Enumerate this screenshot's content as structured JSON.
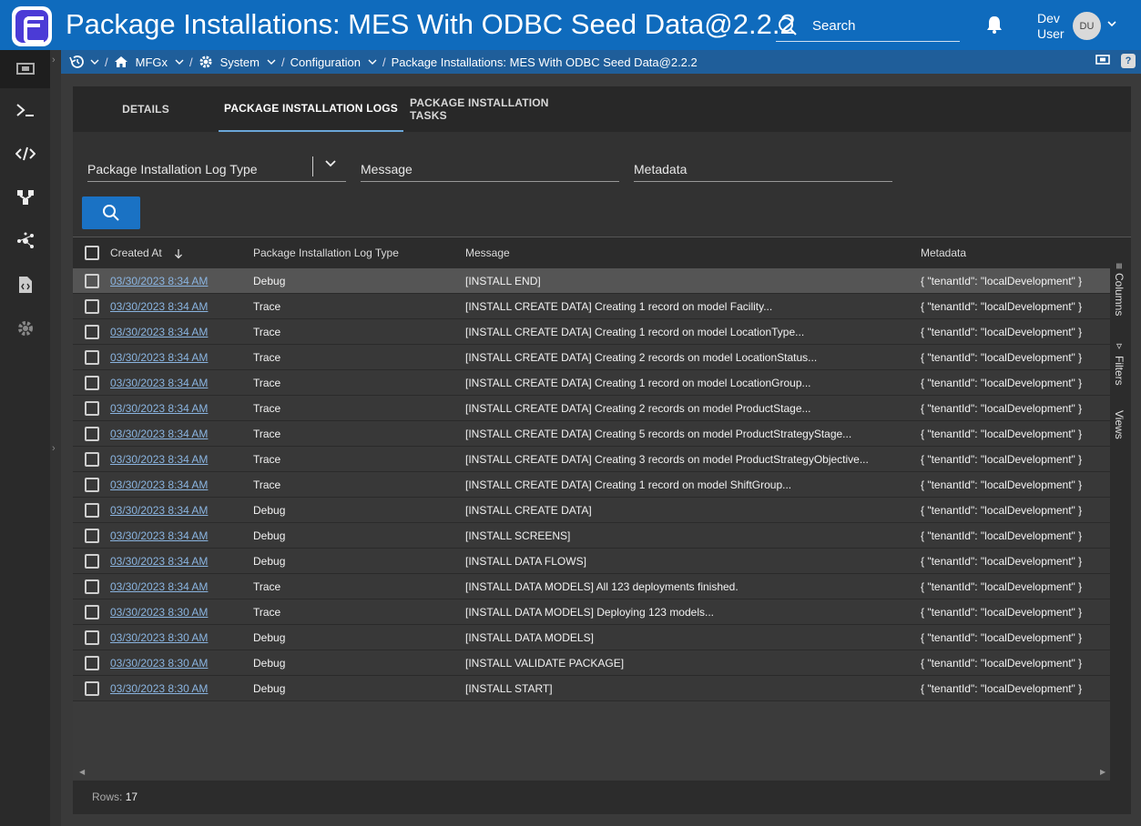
{
  "header": {
    "title": "Package Installations: MES With ODBC Seed Data@2.2.2",
    "search_label": "Search",
    "user_name": "Dev User",
    "user_initials": "DU"
  },
  "breadcrumb": {
    "items": [
      "MFGx",
      "System",
      "Configuration",
      "Package Installations: MES With ODBC Seed Data@2.2.2"
    ]
  },
  "tabs": {
    "details": "DETAILS",
    "logs": "PACKAGE INSTALLATION LOGS",
    "tasks": "PACKAGE INSTALLATION TASKS"
  },
  "filters": {
    "log_type": "Package Installation Log Type",
    "message": "Message",
    "metadata": "Metadata"
  },
  "grid": {
    "columns": {
      "created_at": "Created At",
      "log_type": "Package Installation Log Type",
      "message": "Message",
      "metadata": "Metadata"
    },
    "side_tabs": {
      "columns": "Columns",
      "filters": "Filters",
      "views": "Views"
    },
    "rows": [
      {
        "created": "03/30/2023 8:34 AM",
        "type": "Debug",
        "message": "[INSTALL END]",
        "metadata": "{ \"tenantId\": \"localDevelopment\" }"
      },
      {
        "created": "03/30/2023 8:34 AM",
        "type": "Trace",
        "message": "[INSTALL CREATE DATA] Creating 1 record on model Facility...",
        "metadata": "{ \"tenantId\": \"localDevelopment\" }"
      },
      {
        "created": "03/30/2023 8:34 AM",
        "type": "Trace",
        "message": "[INSTALL CREATE DATA] Creating 1 record on model LocationType...",
        "metadata": "{ \"tenantId\": \"localDevelopment\" }"
      },
      {
        "created": "03/30/2023 8:34 AM",
        "type": "Trace",
        "message": "[INSTALL CREATE DATA] Creating 2 records on model LocationStatus...",
        "metadata": "{ \"tenantId\": \"localDevelopment\" }"
      },
      {
        "created": "03/30/2023 8:34 AM",
        "type": "Trace",
        "message": "[INSTALL CREATE DATA] Creating 1 record on model LocationGroup...",
        "metadata": "{ \"tenantId\": \"localDevelopment\" }"
      },
      {
        "created": "03/30/2023 8:34 AM",
        "type": "Trace",
        "message": "[INSTALL CREATE DATA] Creating 2 records on model ProductStage...",
        "metadata": "{ \"tenantId\": \"localDevelopment\" }"
      },
      {
        "created": "03/30/2023 8:34 AM",
        "type": "Trace",
        "message": "[INSTALL CREATE DATA] Creating 5 records on model ProductStrategyStage...",
        "metadata": "{ \"tenantId\": \"localDevelopment\" }"
      },
      {
        "created": "03/30/2023 8:34 AM",
        "type": "Trace",
        "message": "[INSTALL CREATE DATA] Creating 3 records on model ProductStrategyObjective...",
        "metadata": "{ \"tenantId\": \"localDevelopment\" }"
      },
      {
        "created": "03/30/2023 8:34 AM",
        "type": "Trace",
        "message": "[INSTALL CREATE DATA] Creating 1 record on model ShiftGroup...",
        "metadata": "{ \"tenantId\": \"localDevelopment\" }"
      },
      {
        "created": "03/30/2023 8:34 AM",
        "type": "Debug",
        "message": "[INSTALL CREATE DATA]",
        "metadata": "{ \"tenantId\": \"localDevelopment\" }"
      },
      {
        "created": "03/30/2023 8:34 AM",
        "type": "Debug",
        "message": "[INSTALL SCREENS]",
        "metadata": "{ \"tenantId\": \"localDevelopment\" }"
      },
      {
        "created": "03/30/2023 8:34 AM",
        "type": "Debug",
        "message": "[INSTALL DATA FLOWS]",
        "metadata": "{ \"tenantId\": \"localDevelopment\" }"
      },
      {
        "created": "03/30/2023 8:34 AM",
        "type": "Trace",
        "message": "[INSTALL DATA MODELS] All 123 deployments finished.",
        "metadata": "{ \"tenantId\": \"localDevelopment\" }"
      },
      {
        "created": "03/30/2023 8:30 AM",
        "type": "Trace",
        "message": "[INSTALL DATA MODELS] Deploying 123 models...",
        "metadata": "{ \"tenantId\": \"localDevelopment\" }"
      },
      {
        "created": "03/30/2023 8:30 AM",
        "type": "Debug",
        "message": "[INSTALL DATA MODELS]",
        "metadata": "{ \"tenantId\": \"localDevelopment\" }"
      },
      {
        "created": "03/30/2023 8:30 AM",
        "type": "Debug",
        "message": "[INSTALL VALIDATE PACKAGE]",
        "metadata": "{ \"tenantId\": \"localDevelopment\" }"
      },
      {
        "created": "03/30/2023 8:30 AM",
        "type": "Debug",
        "message": "[INSTALL START]",
        "metadata": "{ \"tenantId\": \"localDevelopment\" }"
      }
    ]
  },
  "footer": {
    "rows_label": "Rows:",
    "rows_count": "17"
  },
  "colors": {
    "header_blue": "#0f6bbd",
    "breadcrumb_blue": "#1f5e9a",
    "button_blue": "#1a72c4",
    "link_blue": "#8ab4e0"
  },
  "icons": [
    "logo-icon",
    "search-icon",
    "bell-icon",
    "chevron-down-icon",
    "history-icon",
    "home-icon",
    "gear-icon",
    "help-icon",
    "terminal-icon",
    "code-icon",
    "flow-icon",
    "network-icon",
    "file-code-icon",
    "sort-down-icon",
    "columns-icon",
    "filter-icon"
  ]
}
